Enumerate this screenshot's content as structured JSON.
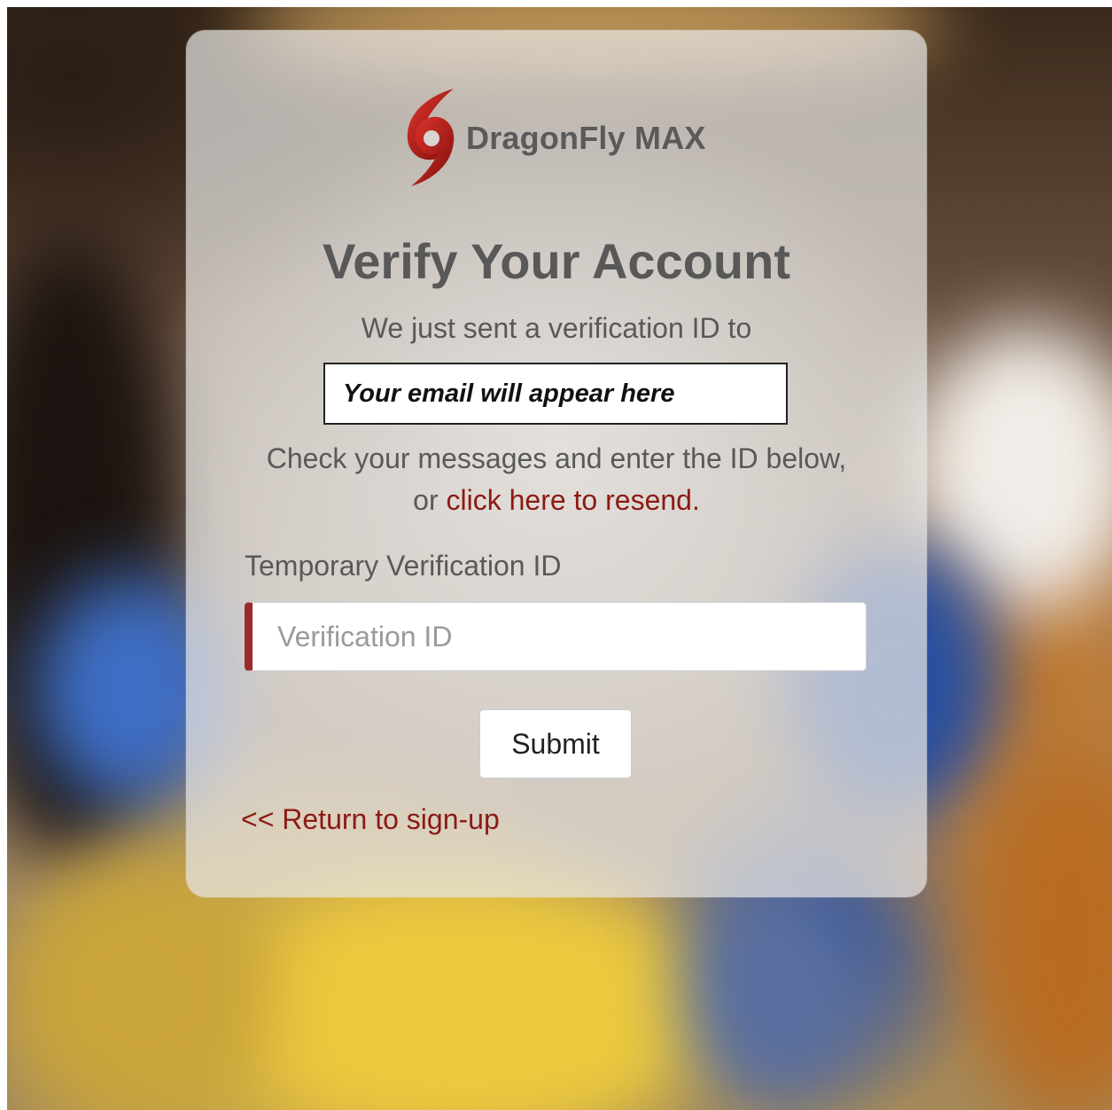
{
  "brand": {
    "name": "DragonFly MAX",
    "logo_icon": "hurricane-icon",
    "logo_color": "#c0231e"
  },
  "page": {
    "title": "Verify Your Account",
    "sent_text": "We just sent a verification ID to",
    "email_placeholder_text": "Your email will appear here",
    "instructions_prefix": "Check your messages and enter the ID below, or ",
    "resend_link": "click here to resend."
  },
  "form": {
    "label": "Temporary Verification ID",
    "input_placeholder": "Verification ID",
    "input_value": "",
    "submit_label": "Submit"
  },
  "footer": {
    "return_link": "<< Return to sign-up"
  },
  "colors": {
    "accent_link": "#8c1a14",
    "input_accent_border": "#9b2a2a",
    "text_gray": "#595959"
  }
}
